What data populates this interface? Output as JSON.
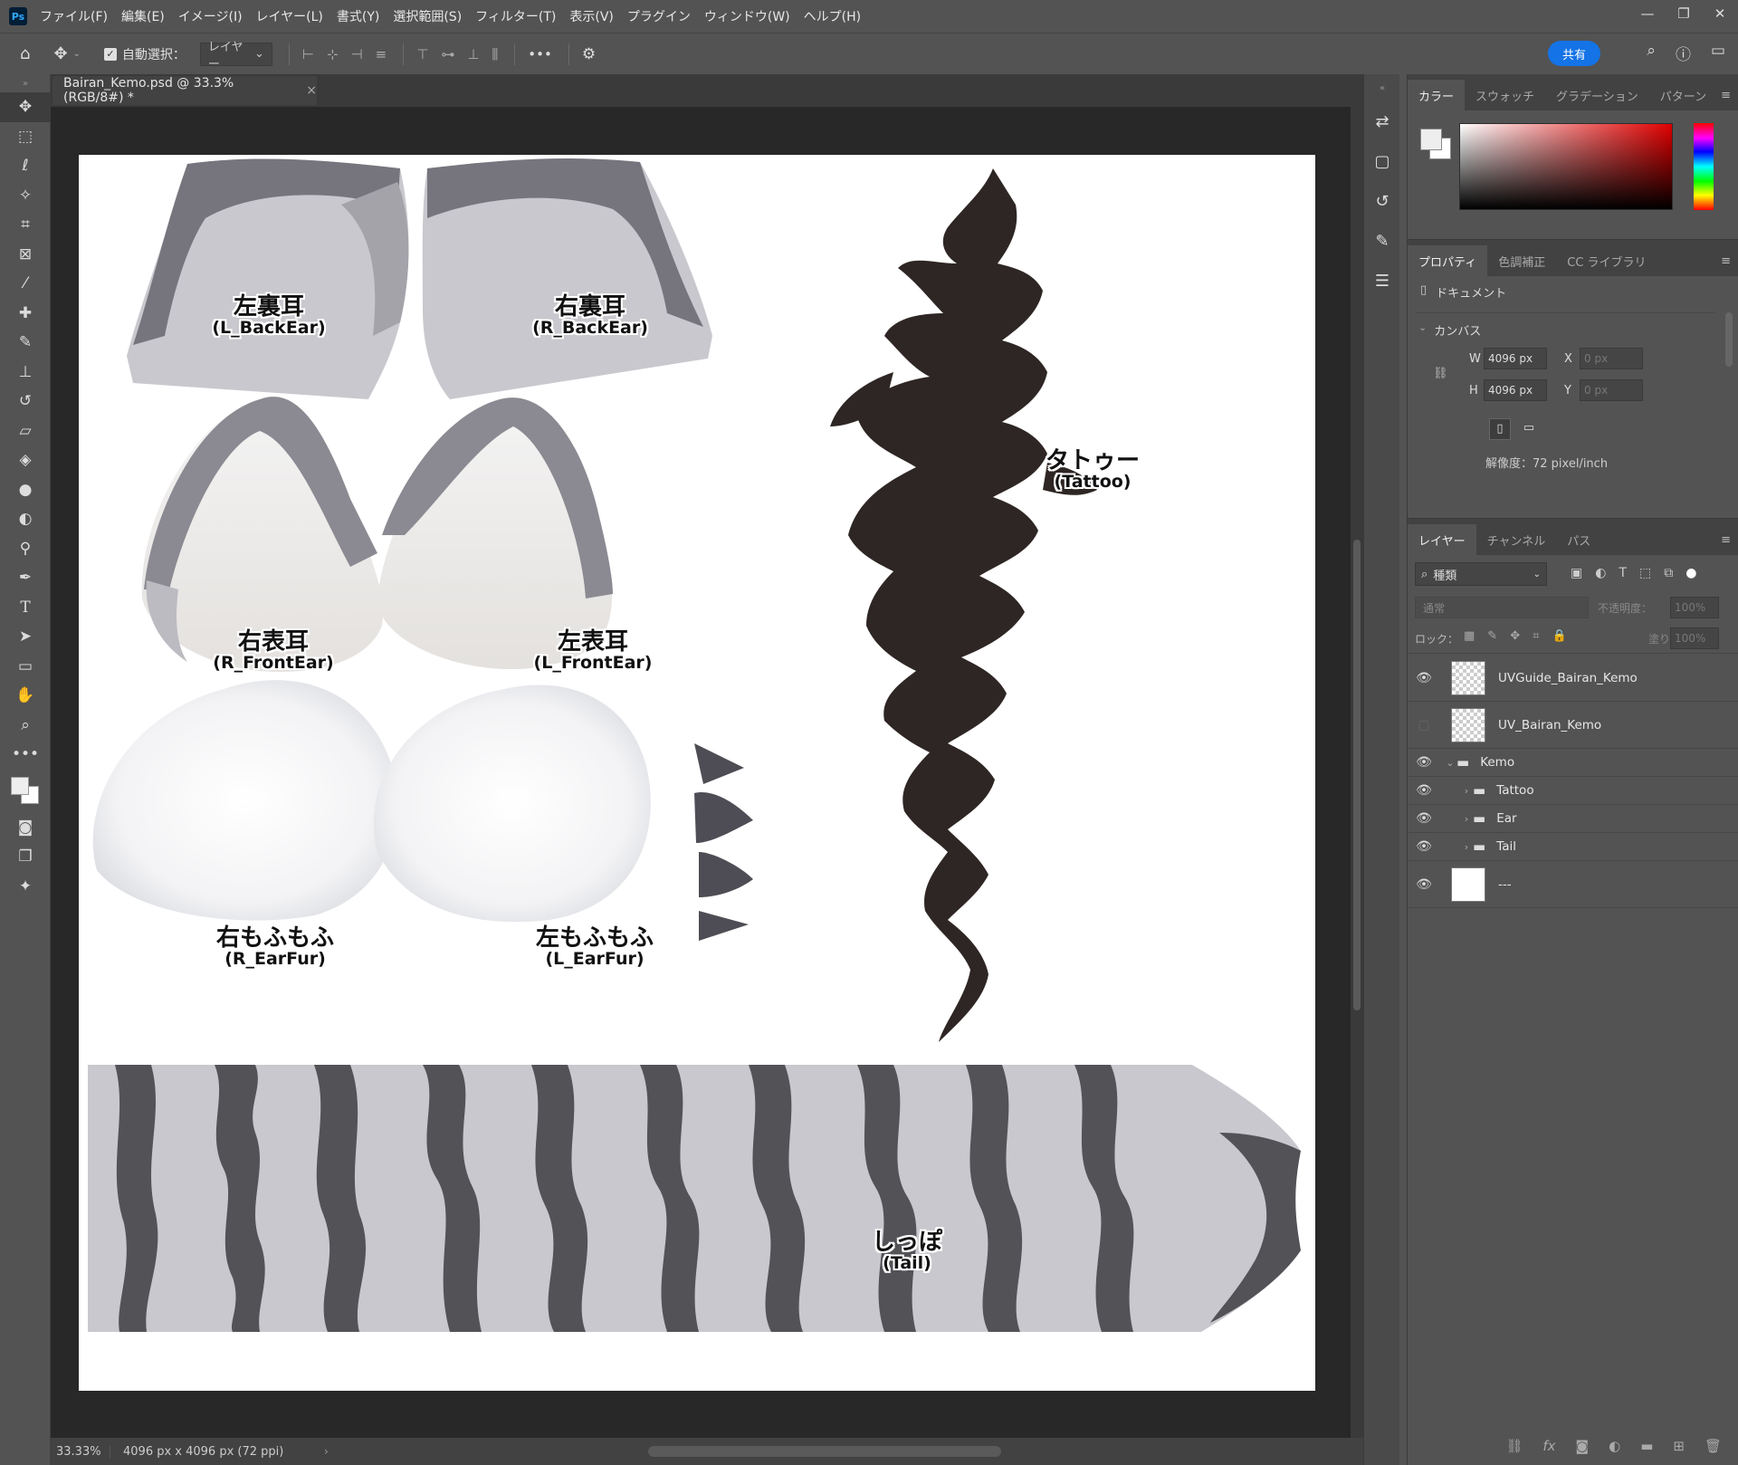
{
  "app": {
    "logo": "Ps"
  },
  "menu": [
    "ファイル(F)",
    "編集(E)",
    "イメージ(I)",
    "レイヤー(L)",
    "書式(Y)",
    "選択範囲(S)",
    "フィルター(T)",
    "表示(V)",
    "プラグイン",
    "ウィンドウ(W)",
    "ヘルプ(H)"
  ],
  "window_controls": {
    "minimize": "—",
    "maximize": "❐",
    "close": "✕"
  },
  "options": {
    "auto_select_label": "自動選択：",
    "auto_select_checked": true,
    "target_value": "レイヤー",
    "share_label": "共有",
    "more": "•••"
  },
  "document": {
    "tab_title": "Bairan_Kemo.psd @ 33.3% (RGB/8#) *",
    "close": "×",
    "zoom": "33.33%",
    "size_info": "4096 px x 4096 px (72 ppi)"
  },
  "uv_labels": [
    {
      "jp": "左裏耳",
      "en": "(L_BackEar)"
    },
    {
      "jp": "右裏耳",
      "en": "(R_BackEar)"
    },
    {
      "jp": "右表耳",
      "en": "(R_FrontEar)"
    },
    {
      "jp": "左表耳",
      "en": "(L_FrontEar)"
    },
    {
      "jp": "右もふもふ",
      "en": "(R_EarFur)"
    },
    {
      "jp": "左もふもふ",
      "en": "(L_EarFur)"
    },
    {
      "jp": "タトゥー",
      "en": "(Tattoo)"
    },
    {
      "jp": "しっぽ",
      "en": "(Tail)"
    }
  ],
  "colors": {
    "ui_bg": "#535353",
    "canvas_bg": "#282828",
    "fur_gray": "#c8c7cc",
    "stripe_dark": "#535257",
    "tattoo": "#2e2624",
    "accent_blue": "#1473e6"
  },
  "color_panel": {
    "tabs": [
      "カラー",
      "スウォッチ",
      "グラデーション",
      "パターン"
    ]
  },
  "properties_panel": {
    "tabs": [
      "プロパティ",
      "色調補正",
      "CC ライブラリ"
    ],
    "doc_label": "ドキュメント",
    "canvas_section": "カンバス",
    "w_label": "W",
    "w_value": "4096 px",
    "h_label": "H",
    "h_value": "4096 px",
    "x_label": "X",
    "x_value": "0 px",
    "y_label": "Y",
    "y_value": "0 px",
    "resolution": "解像度：72 pixel/inch"
  },
  "layers_panel": {
    "tabs": [
      "レイヤー",
      "チャンネル",
      "パス"
    ],
    "filter_kind": "種類",
    "blend_mode": "通常",
    "opacity_label": "不透明度：",
    "opacity_value": "100%",
    "lock_label": "ロック：",
    "fill_label": "塗り：",
    "fill_value": "100%",
    "layers": [
      {
        "name": "UVGuide_Bairan_Kemo",
        "visible": true
      },
      {
        "name": "UV_Bairan_Kemo",
        "visible": false
      },
      {
        "name": "Kemo",
        "visible": true
      },
      {
        "name": "Tattoo",
        "visible": true
      },
      {
        "name": "Ear",
        "visible": true
      },
      {
        "name": "Tail",
        "visible": true
      },
      {
        "name": "---",
        "visible": true
      }
    ]
  }
}
